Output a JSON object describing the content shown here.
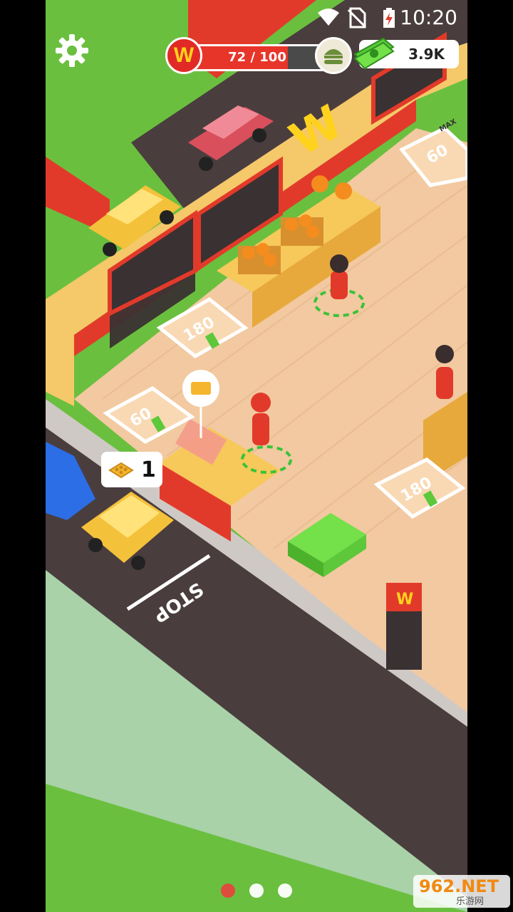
{
  "status_bar": {
    "time": "10:20",
    "icons": [
      "wifi-icon",
      "no-sim-icon",
      "battery-charging-icon"
    ]
  },
  "hud": {
    "settings_icon": "gear-icon",
    "brand_letter": "W",
    "progress": {
      "label": "72 / 100",
      "current": 72,
      "max": 100,
      "fill_color": "#e8352a"
    },
    "burger_icon": "burger-icon",
    "money": {
      "icon": "cash-stack-icon",
      "value": "3.9K"
    },
    "carry": {
      "icon": "bread-tray-icon",
      "count": "1"
    }
  },
  "world": {
    "brand_sign_letter": "W",
    "road_marking": "STOP",
    "upgrade_spots": [
      {
        "cost": "60",
        "icon": "upgrade-arrow-icon",
        "badge": "MAX"
      },
      {
        "cost": "180",
        "icon": "upgrade-arrow-icon"
      },
      {
        "cost": "60",
        "icon": "hire-worker-icon"
      },
      {
        "cost": "180",
        "icon": "upgrade-arrow-icon"
      }
    ]
  },
  "pager": {
    "pages": 3,
    "active_index": 0,
    "active_color": "#e4473c"
  },
  "watermark": {
    "main": "962.NET",
    "sub": "乐游网"
  },
  "colors": {
    "grass": "#6bbf3f",
    "road": "#4a3d3e",
    "floor": "#f2c9a0",
    "wall_red": "#e23a2a",
    "accent_yellow": "#ffd21e"
  }
}
